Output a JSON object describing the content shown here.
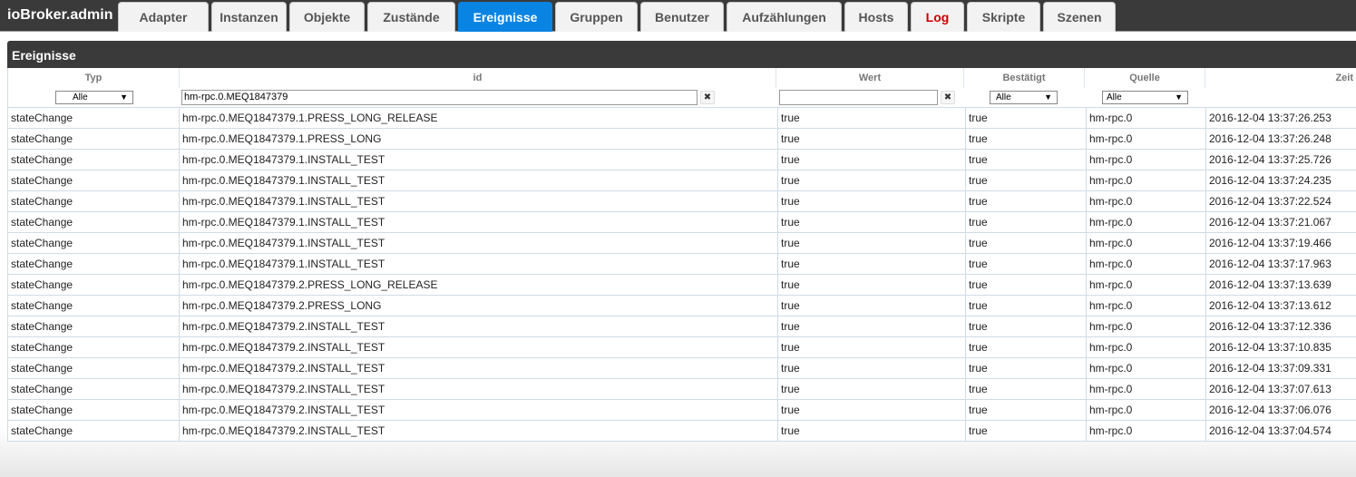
{
  "app": {
    "title": "ioBroker.admin"
  },
  "tabs": [
    {
      "label": "Adapter"
    },
    {
      "label": "Instanzen"
    },
    {
      "label": "Objekte"
    },
    {
      "label": "Zustände"
    },
    {
      "label": "Ereignisse",
      "active": true
    },
    {
      "label": "Gruppen"
    },
    {
      "label": "Benutzer"
    },
    {
      "label": "Aufzählungen"
    },
    {
      "label": "Hosts"
    },
    {
      "label": "Log",
      "color": "#cc0000"
    },
    {
      "label": "Skripte"
    },
    {
      "label": "Szenen"
    }
  ],
  "panel": {
    "title": "Ereignisse"
  },
  "columns": {
    "typ": "Typ",
    "id": "id",
    "wert": "Wert",
    "bestaetigt": "Bestätigt",
    "quelle": "Quelle",
    "zeit": "Zeit"
  },
  "filters": {
    "typ": "Alle",
    "id": "hm-rpc.0.MEQ1847379",
    "wert": "",
    "bestaetigt": "Alle",
    "quelle": "Alle",
    "clear_icon": "✖",
    "dropdown_icon": "▼"
  },
  "rows": [
    {
      "typ": "stateChange",
      "id": "hm-rpc.0.MEQ1847379.1.PRESS_LONG_RELEASE",
      "wert": "true",
      "bestaetigt": "true",
      "quelle": "hm-rpc.0",
      "zeit": "2016-12-04 13:37:26.253"
    },
    {
      "typ": "stateChange",
      "id": "hm-rpc.0.MEQ1847379.1.PRESS_LONG",
      "wert": "true",
      "bestaetigt": "true",
      "quelle": "hm-rpc.0",
      "zeit": "2016-12-04 13:37:26.248"
    },
    {
      "typ": "stateChange",
      "id": "hm-rpc.0.MEQ1847379.1.INSTALL_TEST",
      "wert": "true",
      "bestaetigt": "true",
      "quelle": "hm-rpc.0",
      "zeit": "2016-12-04 13:37:25.726"
    },
    {
      "typ": "stateChange",
      "id": "hm-rpc.0.MEQ1847379.1.INSTALL_TEST",
      "wert": "true",
      "bestaetigt": "true",
      "quelle": "hm-rpc.0",
      "zeit": "2016-12-04 13:37:24.235"
    },
    {
      "typ": "stateChange",
      "id": "hm-rpc.0.MEQ1847379.1.INSTALL_TEST",
      "wert": "true",
      "bestaetigt": "true",
      "quelle": "hm-rpc.0",
      "zeit": "2016-12-04 13:37:22.524"
    },
    {
      "typ": "stateChange",
      "id": "hm-rpc.0.MEQ1847379.1.INSTALL_TEST",
      "wert": "true",
      "bestaetigt": "true",
      "quelle": "hm-rpc.0",
      "zeit": "2016-12-04 13:37:21.067"
    },
    {
      "typ": "stateChange",
      "id": "hm-rpc.0.MEQ1847379.1.INSTALL_TEST",
      "wert": "true",
      "bestaetigt": "true",
      "quelle": "hm-rpc.0",
      "zeit": "2016-12-04 13:37:19.466"
    },
    {
      "typ": "stateChange",
      "id": "hm-rpc.0.MEQ1847379.1.INSTALL_TEST",
      "wert": "true",
      "bestaetigt": "true",
      "quelle": "hm-rpc.0",
      "zeit": "2016-12-04 13:37:17.963"
    },
    {
      "typ": "stateChange",
      "id": "hm-rpc.0.MEQ1847379.2.PRESS_LONG_RELEASE",
      "wert": "true",
      "bestaetigt": "true",
      "quelle": "hm-rpc.0",
      "zeit": "2016-12-04 13:37:13.639"
    },
    {
      "typ": "stateChange",
      "id": "hm-rpc.0.MEQ1847379.2.PRESS_LONG",
      "wert": "true",
      "bestaetigt": "true",
      "quelle": "hm-rpc.0",
      "zeit": "2016-12-04 13:37:13.612"
    },
    {
      "typ": "stateChange",
      "id": "hm-rpc.0.MEQ1847379.2.INSTALL_TEST",
      "wert": "true",
      "bestaetigt": "true",
      "quelle": "hm-rpc.0",
      "zeit": "2016-12-04 13:37:12.336"
    },
    {
      "typ": "stateChange",
      "id": "hm-rpc.0.MEQ1847379.2.INSTALL_TEST",
      "wert": "true",
      "bestaetigt": "true",
      "quelle": "hm-rpc.0",
      "zeit": "2016-12-04 13:37:10.835"
    },
    {
      "typ": "stateChange",
      "id": "hm-rpc.0.MEQ1847379.2.INSTALL_TEST",
      "wert": "true",
      "bestaetigt": "true",
      "quelle": "hm-rpc.0",
      "zeit": "2016-12-04 13:37:09.331"
    },
    {
      "typ": "stateChange",
      "id": "hm-rpc.0.MEQ1847379.2.INSTALL_TEST",
      "wert": "true",
      "bestaetigt": "true",
      "quelle": "hm-rpc.0",
      "zeit": "2016-12-04 13:37:07.613"
    },
    {
      "typ": "stateChange",
      "id": "hm-rpc.0.MEQ1847379.2.INSTALL_TEST",
      "wert": "true",
      "bestaetigt": "true",
      "quelle": "hm-rpc.0",
      "zeit": "2016-12-04 13:37:06.076"
    },
    {
      "typ": "stateChange",
      "id": "hm-rpc.0.MEQ1847379.2.INSTALL_TEST",
      "wert": "true",
      "bestaetigt": "true",
      "quelle": "hm-rpc.0",
      "zeit": "2016-12-04 13:37:04.574"
    }
  ],
  "colors": {
    "topbar": "#3a3a3a",
    "active_tab": "#0a84e3",
    "log_tab": "#cc0000"
  }
}
